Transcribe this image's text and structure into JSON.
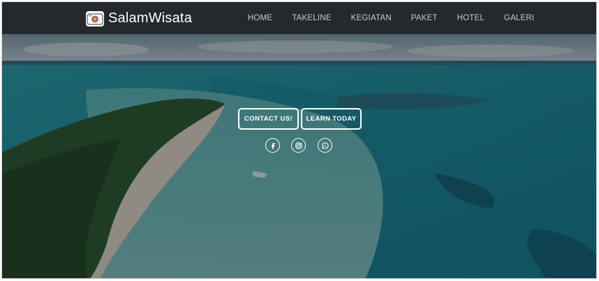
{
  "brand": {
    "name": "SalamWisata",
    "logo_icon": "camera-icon"
  },
  "nav": {
    "items": [
      {
        "label": "HOME"
      },
      {
        "label": "TAKELINE"
      },
      {
        "label": "KEGIATAN"
      },
      {
        "label": "PAKET"
      },
      {
        "label": "HOTEL"
      },
      {
        "label": "GALERI"
      }
    ]
  },
  "hero": {
    "buttons": {
      "contact": "CONTACT US!",
      "learn": "LEARN TODAY"
    },
    "social": [
      "facebook-icon",
      "instagram-icon",
      "whatsapp-icon"
    ]
  },
  "colors": {
    "navbar_bg": "#25282c",
    "nav_text": "#c9ccd0",
    "button_border": "#ffffff",
    "sea": "#1e8fa0",
    "sand": "#e8d9c7",
    "forest": "#234022"
  }
}
